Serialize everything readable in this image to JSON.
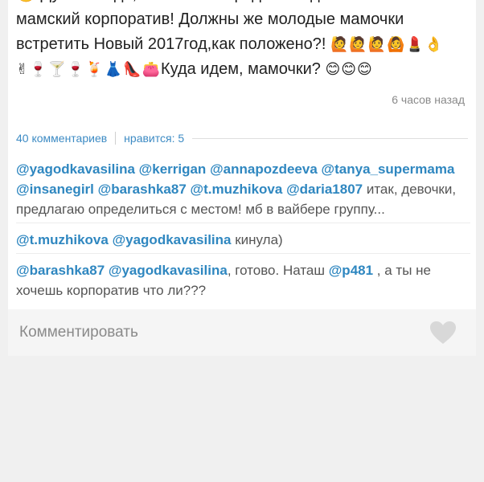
{
  "post": {
    "line1": "🙂 Думаю надо, чтобы был предновогодний мамочкин",
    "line2": "мамский корпоратив! Должны же молодые мамочки",
    "line3_text": "встретить Новый 2017год,как положено?! ",
    "line3_emojis": "🙋🙋🙋🙆💄👌",
    "line4_emojis": "✌🍷🍸🍷🍹👗👠👛",
    "line4_text": "Куда идем, мамочки? ",
    "line4_smileys": "😊😊😊",
    "timestamp": "6 часов назад"
  },
  "stats": {
    "comments": "40 комментариев",
    "likes": "нравится: 5"
  },
  "comments": [
    {
      "mentions": [
        "@yagodkavasilina",
        "@kerrigan",
        "@annapozdeeva",
        "@tanya_supermama",
        "@insanegirl",
        "@barashka87",
        "@t.muzhikova",
        "@daria1807"
      ],
      "text": "итак, девочки, предлагаю определиться с местом!  мб в вайбере группу..."
    },
    {
      "mentions": [
        "@t.muzhikova",
        "@yagodkavasilina"
      ],
      "text": "кинула)"
    },
    {
      "mentions": [
        "@barashka87",
        "@yagodkavasilina"
      ],
      "text_a": ", готово. Наташ ",
      "mention_b": "@p481",
      "text_b": " , а ты не хочешь корпоратив что ли???"
    }
  ],
  "comment_bar": {
    "placeholder": "Комментировать"
  },
  "colors": {
    "mention": "#2f87c0",
    "stats": "#3d8bc4",
    "heart": "#d8d8d8"
  }
}
